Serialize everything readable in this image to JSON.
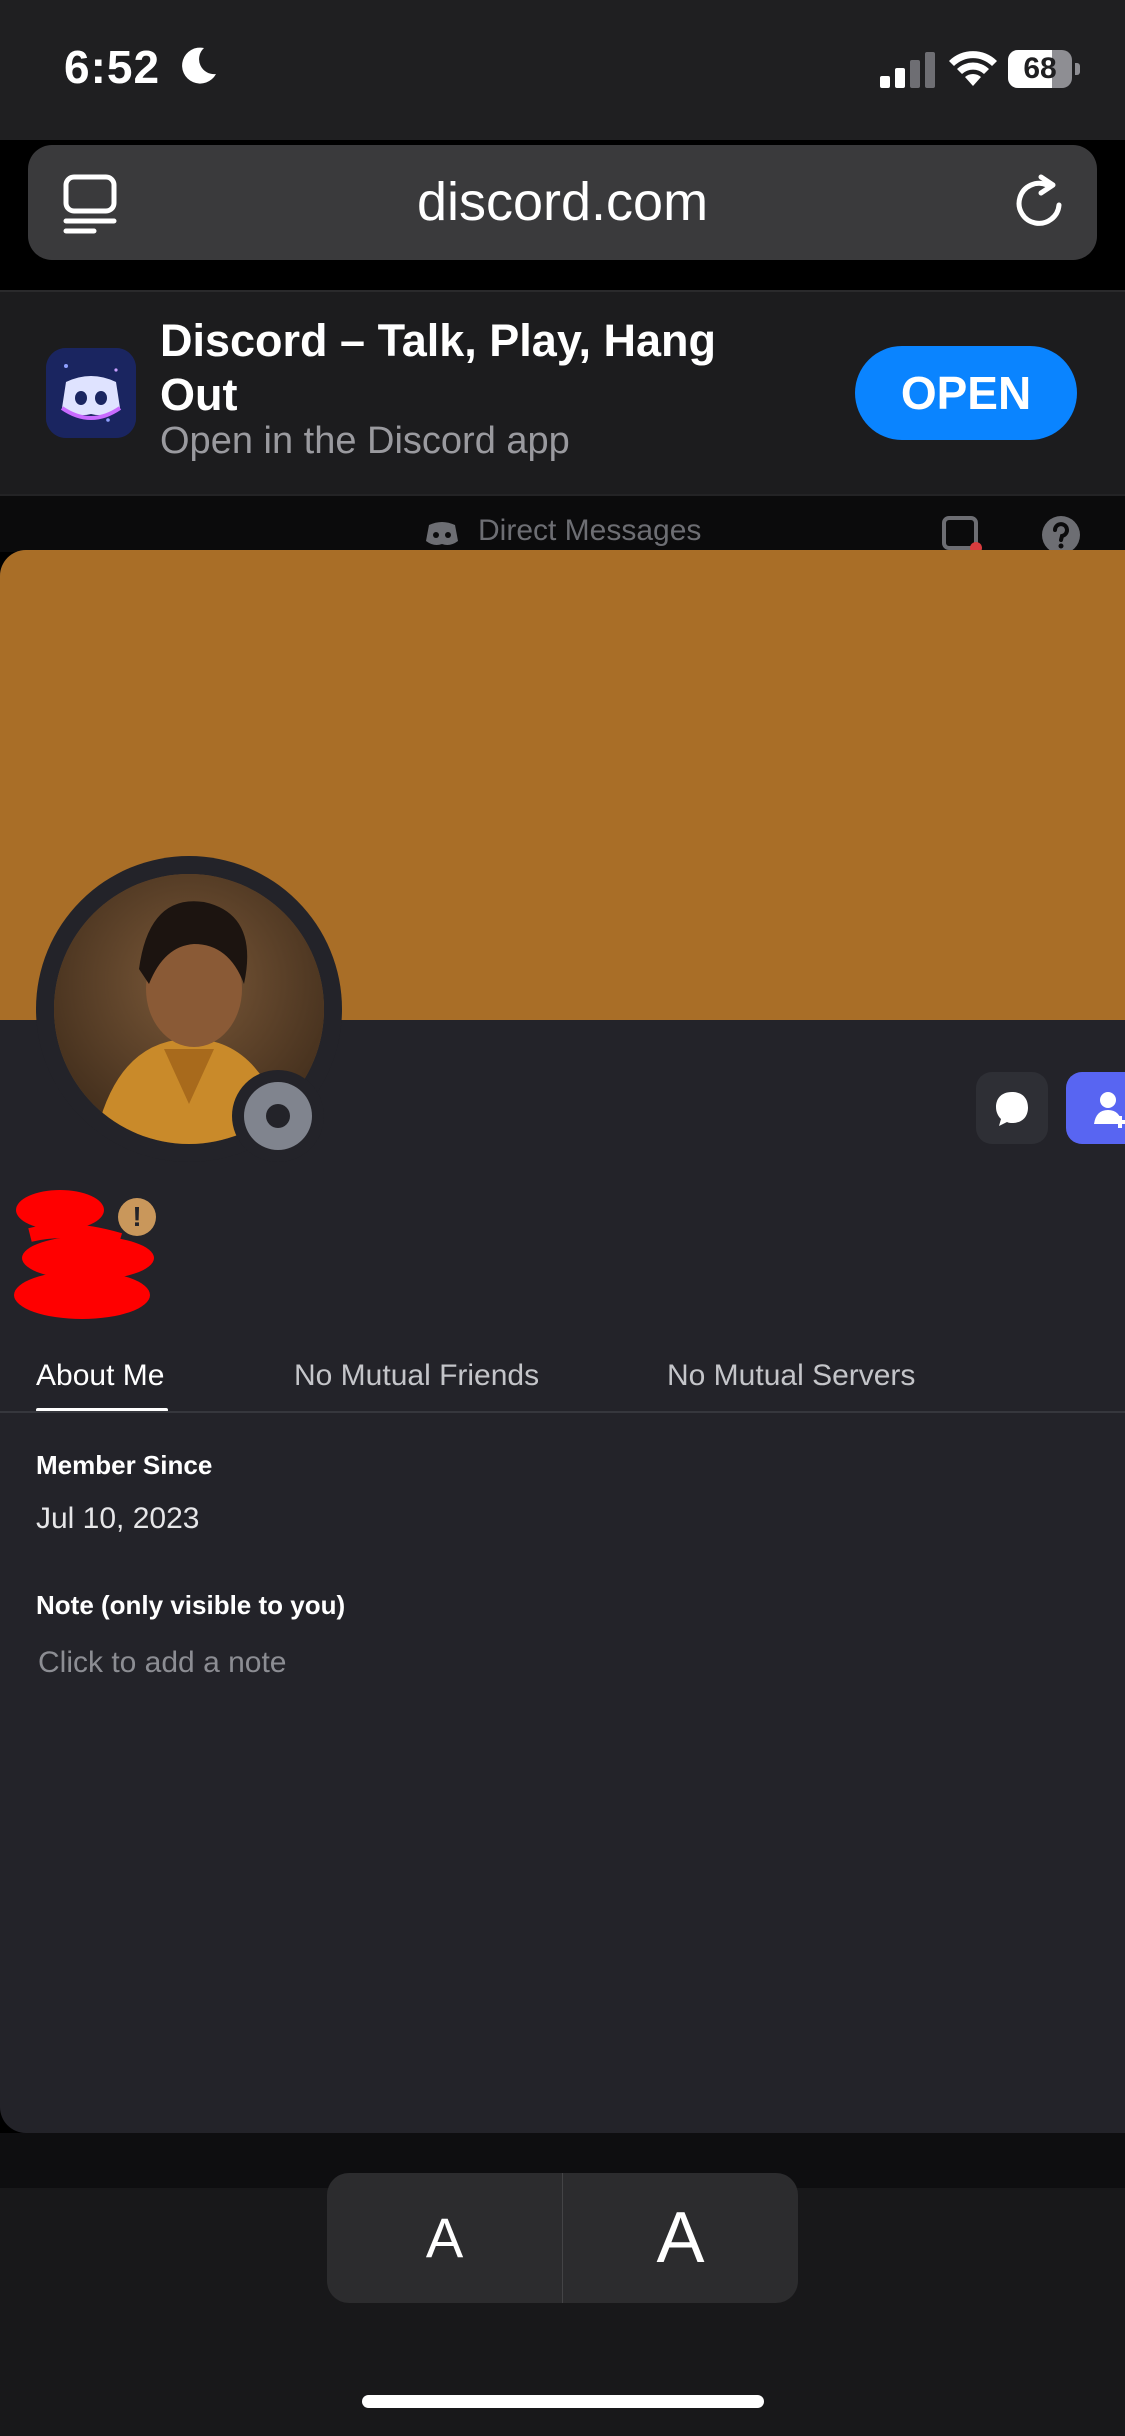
{
  "status_bar": {
    "time": "6:52",
    "battery_percent": "68",
    "battery_level": 0.68,
    "icons": [
      "moon-icon",
      "signal-icon",
      "wifi-icon",
      "battery-icon"
    ]
  },
  "browser": {
    "url": "discord.com",
    "icons": [
      "tabs-icon",
      "reload-icon"
    ]
  },
  "app_banner": {
    "title": "Discord – Talk, Play, Hang Out",
    "subtitle": "Open in the Discord app",
    "open_label": "OPEN",
    "accent": "#0a84ff"
  },
  "dm_bar": {
    "label": "Direct Messages",
    "icons": [
      "discord-icon",
      "inbox-icon",
      "help-icon"
    ]
  },
  "profile": {
    "banner_color": "#a96e27",
    "warning_badge": "!",
    "status": "offline",
    "buttons": [
      "message-icon",
      "add-friend-icon"
    ],
    "add_friend_color": "#5865f2",
    "tabs": [
      {
        "label": "About Me",
        "active": true
      },
      {
        "label": "No Mutual Friends",
        "active": false
      },
      {
        "label": "No Mutual Servers",
        "active": false
      }
    ],
    "member_since_label": "Member Since",
    "member_since_value": "Jul 10, 2023",
    "note_label": "Note (only visible to you)",
    "note_placeholder": "Click to add a note"
  },
  "font_size_control": {
    "small_label": "A",
    "large_label": "A"
  }
}
